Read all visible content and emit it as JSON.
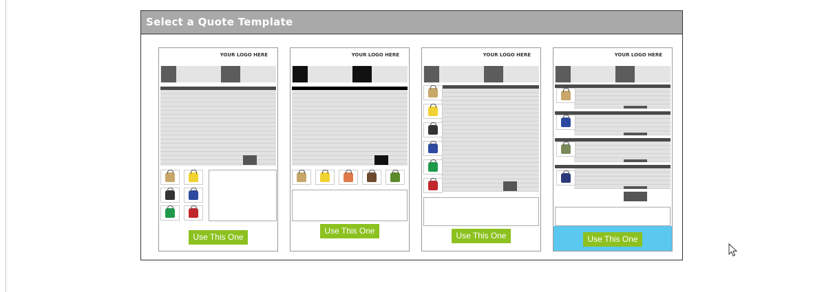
{
  "dialog": {
    "title": "Select a Quote Template"
  },
  "templates": [
    {
      "logo_text": "YOUR LOGO HERE",
      "button_label": "Use This One"
    },
    {
      "logo_text": "YOUR LOGO HERE",
      "button_label": "Use This One"
    },
    {
      "logo_text": "YOUR LOGO HERE",
      "button_label": "Use This One"
    },
    {
      "logo_text": "YOUR LOGO HERE",
      "button_label": "Use This One"
    }
  ],
  "colors": {
    "header_bg": "#a9a9a9",
    "button_green": "#8cc11f",
    "selected_footer": "#5bc8ef"
  },
  "icons": {
    "cursor": "mouse-pointer-icon",
    "thumbnails": "bag-product-icon"
  }
}
